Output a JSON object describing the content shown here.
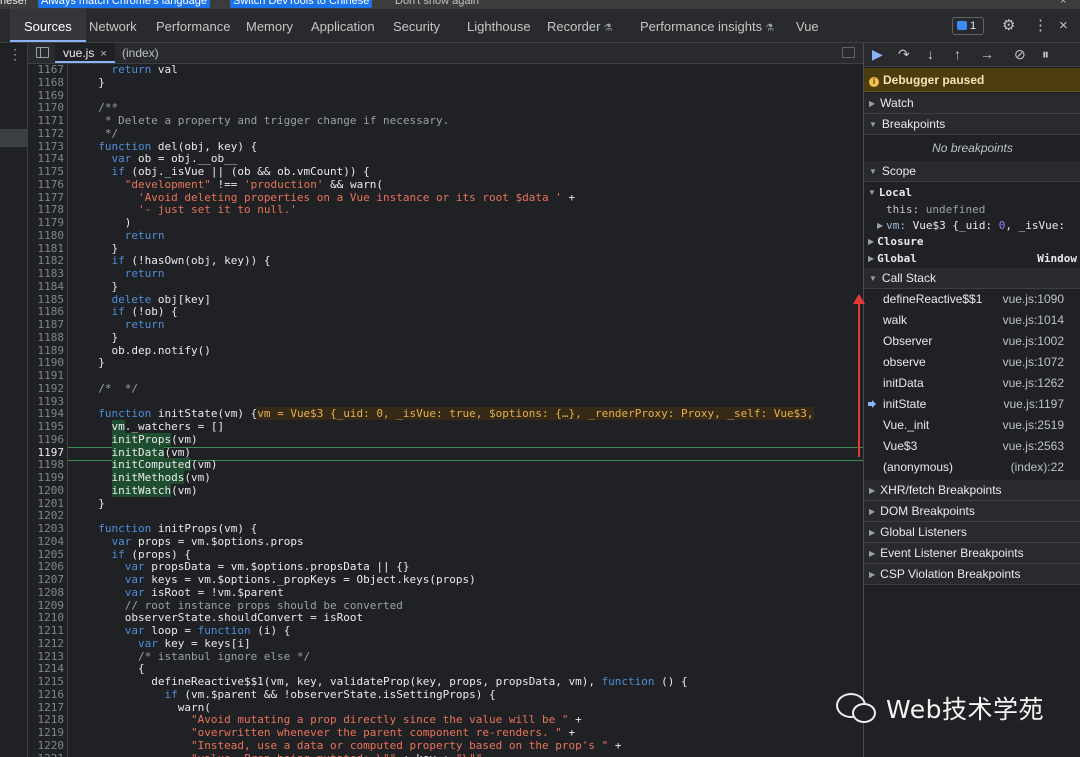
{
  "notification": {
    "text": "nese!",
    "button_match": "Always match Chrome's language",
    "button_switch": "Switch DevTools to Chinese",
    "dont_show": "Don't show again",
    "close": "×"
  },
  "main_tabs": [
    {
      "label": "Sources",
      "active": true
    },
    {
      "label": "Network"
    },
    {
      "label": "Performance"
    },
    {
      "label": "Memory"
    },
    {
      "label": "Application"
    },
    {
      "label": "Security"
    },
    {
      "label": "Lighthouse"
    },
    {
      "label": "Recorder",
      "experimental": true
    },
    {
      "label": "Performance insights",
      "experimental": true
    },
    {
      "label": "Vue"
    }
  ],
  "issues_count": "1",
  "toolbar_icons": {
    "settings": "⚙",
    "more": "⋮",
    "close": "×"
  },
  "editor_tabs": [
    {
      "label": "vue.js",
      "active": true,
      "close": "×"
    },
    {
      "label": "(index)"
    }
  ],
  "debugger": {
    "paused_label": "Debugger paused",
    "sections": {
      "watch": "Watch",
      "breakpoints": "Breakpoints",
      "no_breakpoints": "No breakpoints",
      "scope": "Scope",
      "call_stack": "Call Stack",
      "xhr": "XHR/fetch Breakpoints",
      "dom": "DOM Breakpoints",
      "global_listeners": "Global Listeners",
      "event_listeners": "Event Listener Breakpoints",
      "csp": "CSP Violation Breakpoints"
    },
    "scope": {
      "local": "Local",
      "this_key": "this:",
      "this_val": "undefined",
      "vm_key": "vm:",
      "vm_val_a": "Vue$3 {_uid:",
      "vm_uid": "0",
      "vm_val_b": ", _isVue:",
      "closure": "Closure",
      "global": "Global",
      "global_val": "Window"
    },
    "call_stack": [
      {
        "fn": "defineReactive$$1",
        "loc": "vue.js:1090"
      },
      {
        "fn": "walk",
        "loc": "vue.js:1014"
      },
      {
        "fn": "Observer",
        "loc": "vue.js:1002"
      },
      {
        "fn": "observe",
        "loc": "vue.js:1072"
      },
      {
        "fn": "initData",
        "loc": "vue.js:1262"
      },
      {
        "fn": "initState",
        "loc": "vue.js:1197",
        "current": true
      },
      {
        "fn": "Vue._init",
        "loc": "vue.js:2519"
      },
      {
        "fn": "Vue$3",
        "loc": "vue.js:2563"
      },
      {
        "fn": "(anonymous)",
        "loc": "(index):22"
      }
    ]
  },
  "code_lines": [
    {
      "n": "1167",
      "t": "    return val"
    },
    {
      "n": "1168",
      "t": "  }"
    },
    {
      "n": "1169",
      "t": ""
    },
    {
      "n": "1170",
      "t": "  /**"
    },
    {
      "n": "1171",
      "t": "   * Delete a property and trigger change if necessary."
    },
    {
      "n": "1172",
      "t": "   */"
    },
    {
      "n": "1173",
      "t": "  function del(obj, key) {"
    },
    {
      "n": "1174",
      "t": "    var ob = obj.__ob__"
    },
    {
      "n": "1175",
      "t": "    if (obj._isVue || (ob && ob.vmCount)) {"
    },
    {
      "n": "1176",
      "t": "      \"development\" !== 'production' && warn("
    },
    {
      "n": "1177",
      "t": "        'Avoid deleting properties on a Vue instance or its root $data ' +"
    },
    {
      "n": "1178",
      "t": "        '- just set it to null.'"
    },
    {
      "n": "1179",
      "t": "      )"
    },
    {
      "n": "1180",
      "t": "      return"
    },
    {
      "n": "1181",
      "t": "    }"
    },
    {
      "n": "1182",
      "t": "    if (!hasOwn(obj, key)) {"
    },
    {
      "n": "1183",
      "t": "      return"
    },
    {
      "n": "1184",
      "t": "    }"
    },
    {
      "n": "1185",
      "t": "    delete obj[key]"
    },
    {
      "n": "1186",
      "t": "    if (!ob) {"
    },
    {
      "n": "1187",
      "t": "      return"
    },
    {
      "n": "1188",
      "t": "    }"
    },
    {
      "n": "1189",
      "t": "    ob.dep.notify()"
    },
    {
      "n": "1190",
      "t": "  }"
    },
    {
      "n": "1191",
      "t": ""
    },
    {
      "n": "1192",
      "t": "  /*  */"
    },
    {
      "n": "1193",
      "t": ""
    },
    {
      "n": "1194",
      "t": "  function initState(vm) {",
      "inline": "vm = Vue$3 {_uid: 0, _isVue: true, $options: {…}, _renderProxy: Proxy, _self: Vue$3,"
    },
    {
      "n": "1195",
      "t": "    vm._watchers = []"
    },
    {
      "n": "1196",
      "t": "    initProps(vm)"
    },
    {
      "n": "1197",
      "t": "    initData(vm)",
      "current": true
    },
    {
      "n": "1198",
      "t": "    initComputed(vm)"
    },
    {
      "n": "1199",
      "t": "    initMethods(vm)"
    },
    {
      "n": "1200",
      "t": "    initWatch(vm)"
    },
    {
      "n": "1201",
      "t": "  }"
    },
    {
      "n": "1202",
      "t": ""
    },
    {
      "n": "1203",
      "t": "  function initProps(vm) {"
    },
    {
      "n": "1204",
      "t": "    var props = vm.$options.props"
    },
    {
      "n": "1205",
      "t": "    if (props) {"
    },
    {
      "n": "1206",
      "t": "      var propsData = vm.$options.propsData || {}"
    },
    {
      "n": "1207",
      "t": "      var keys = vm.$options._propKeys = Object.keys(props)"
    },
    {
      "n": "1208",
      "t": "      var isRoot = !vm.$parent"
    },
    {
      "n": "1209",
      "t": "      // root instance props should be converted"
    },
    {
      "n": "1210",
      "t": "      observerState.shouldConvert = isRoot"
    },
    {
      "n": "1211",
      "t": "      var loop = function (i) {"
    },
    {
      "n": "1212",
      "t": "        var key = keys[i]"
    },
    {
      "n": "1213",
      "t": "        /* istanbul ignore else */"
    },
    {
      "n": "1214",
      "t": "        {"
    },
    {
      "n": "1215",
      "t": "          defineReactive$$1(vm, key, validateProp(key, props, propsData, vm), function () {"
    },
    {
      "n": "1216",
      "t": "            if (vm.$parent && !observerState.isSettingProps) {"
    },
    {
      "n": "1217",
      "t": "              warn("
    },
    {
      "n": "1218",
      "t": "                \"Avoid mutating a prop directly since the value will be \" +"
    },
    {
      "n": "1219",
      "t": "                \"overwritten whenever the parent component re-renders. \" +"
    },
    {
      "n": "1220",
      "t": "                \"Instead, use a data or computed property based on the prop's \" +"
    },
    {
      "n": "1221",
      "t": "                \"value. Prop being mutated: \\\"\" + key + \"\\\"\""
    }
  ],
  "watermark": "Web技术学苑",
  "colors": {
    "accent": "#8ab4f8",
    "paused_bg": "#4c3d0e",
    "annotation_arrow": "#e53935",
    "current_line_border": "#3b8f4c"
  }
}
